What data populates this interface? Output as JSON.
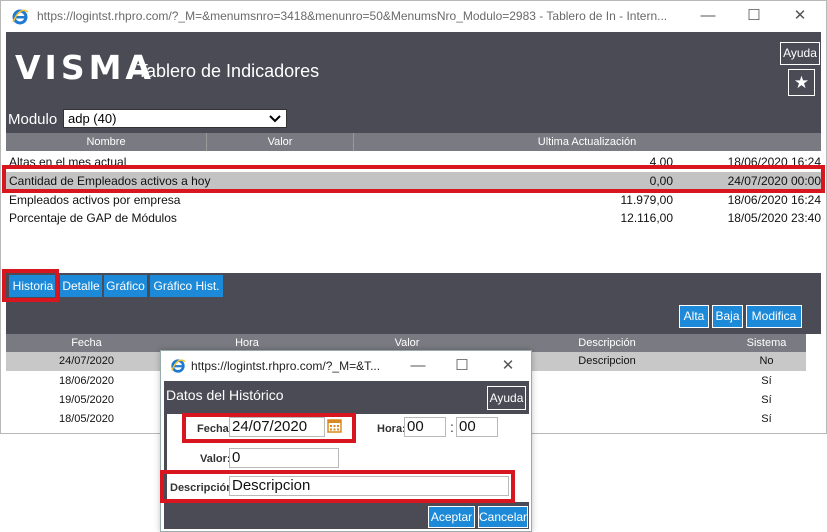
{
  "window": {
    "title": "https://logintst.rhpro.com/?_M=&menumsnro=3418&menunro=50&MenumsNro_Modulo=2983 - Tablero de In - Intern...",
    "minimize": "—",
    "maximize": "☐",
    "close": "✕"
  },
  "header": {
    "logo": "VISMA",
    "title": "Tablero de Indicadores",
    "ayuda": "Ayuda"
  },
  "modulo": {
    "label": "Modulo",
    "selected": "adp (40)"
  },
  "indicators": {
    "columns": [
      "Nombre",
      "Valor",
      "Ultima Actualización"
    ],
    "rows": [
      {
        "nombre": "Altas en el mes actual",
        "valor": "4,00",
        "fecha": "18/06/2020 16:24"
      },
      {
        "nombre": "Cantidad de Empleados activos a hoy",
        "valor": "0,00",
        "fecha": "24/07/2020 00:00"
      },
      {
        "nombre": "Empleados activos por empresa",
        "valor": "11.979,00",
        "fecha": "18/06/2020 16:24"
      },
      {
        "nombre": "Porcentaje de GAP de Módulos",
        "valor": "12.116,00",
        "fecha": "18/05/2020 23:40"
      }
    ]
  },
  "tabs": [
    "Historia",
    "Detalle",
    "Gráfico",
    "Gráfico Hist."
  ],
  "history_toolbar": {
    "alta": "Alta",
    "baja": "Baja",
    "modifica": "Modifica"
  },
  "history": {
    "columns": [
      "Fecha",
      "Hora",
      "Valor",
      "Descripción",
      "Sistema"
    ],
    "rows": [
      {
        "fecha": "24/07/2020",
        "descripcion": "Descripcion",
        "sistema": "No"
      },
      {
        "fecha": "18/06/2020",
        "descripcion": "",
        "sistema": "Sí"
      },
      {
        "fecha": "19/05/2020",
        "descripcion": "",
        "sistema": "Sí"
      },
      {
        "fecha": "18/05/2020",
        "descripcion": "",
        "sistema": "Sí"
      }
    ]
  },
  "dialog": {
    "title": "https://logintst.rhpro.com/?_M=&T...",
    "heading": "Datos del Histórico",
    "ayuda": "Ayuda",
    "fecha_label": "Fecha:",
    "fecha_value": "24/07/2020",
    "hora_label": "Hora:",
    "hora_h": "00",
    "hora_sep": ":",
    "hora_m": "00",
    "valor_label": "Valor:",
    "valor_value": "0",
    "desc_label": "Descripción:",
    "desc_value": "Descripcion",
    "aceptar": "Aceptar",
    "cancelar": "Cancelar"
  },
  "colors": {
    "header_bg": "#4a4b55",
    "button_blue": "#1c8ad8",
    "highlight_red": "#d8161f",
    "grid_header": "#7a7b82",
    "selected_row": "#c3c3c3"
  }
}
